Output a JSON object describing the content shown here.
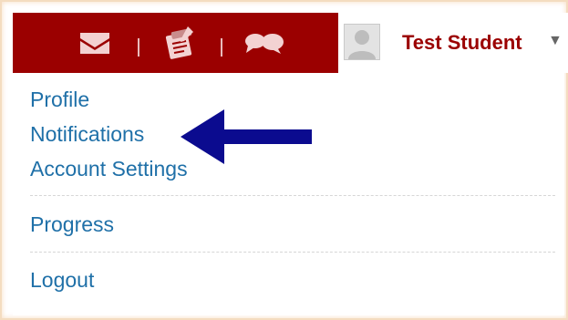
{
  "header": {
    "icons": [
      {
        "name": "messages-icon"
      },
      {
        "name": "assignments-icon"
      },
      {
        "name": "discussions-icon"
      }
    ],
    "colors": {
      "bar": "#9b0000",
      "icon": "#f3d2d2"
    }
  },
  "user": {
    "name": "Test Student",
    "avatar_icon": "default-avatar-icon",
    "dropdown_icon": "caret-down-icon"
  },
  "menu": {
    "items": [
      {
        "label": "Profile"
      },
      {
        "label": "Notifications"
      },
      {
        "label": "Account Settings"
      },
      {
        "label": "Progress"
      },
      {
        "label": "Logout"
      }
    ],
    "link_color": "#1f70a8"
  },
  "annotation": {
    "arrow_color": "#0b0b8f",
    "points_to": "Notifications"
  }
}
